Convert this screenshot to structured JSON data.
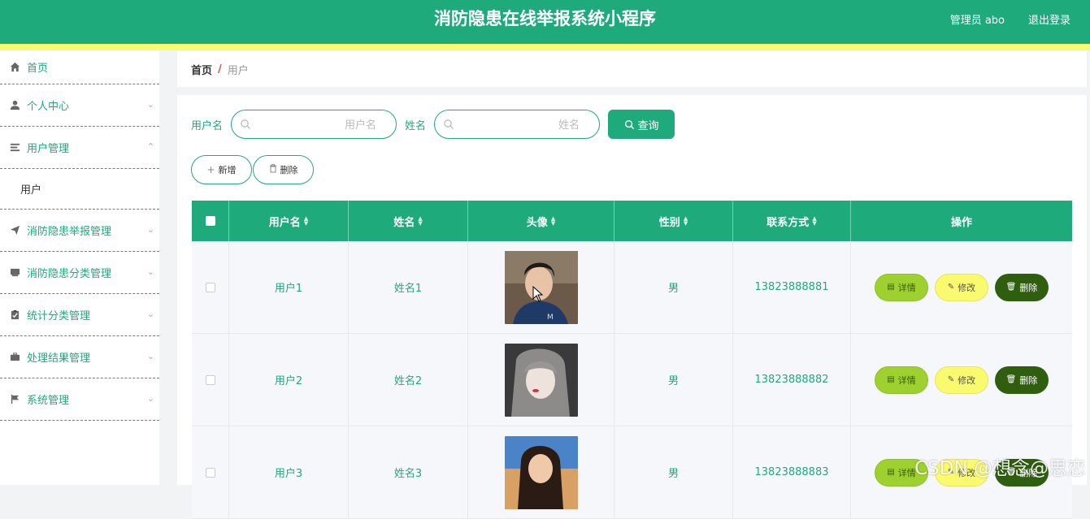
{
  "header": {
    "title": "消防隐患在线举报系统小程序",
    "user": "管理员 abo",
    "logout": "退出登录"
  },
  "sidebar": {
    "items": [
      {
        "label": "首页",
        "icon": "home-icon"
      },
      {
        "label": "个人中心",
        "icon": "person-icon"
      },
      {
        "label": "用户管理",
        "icon": "list-icon",
        "expanded": true
      },
      {
        "label": "消防隐患举报管理",
        "icon": "send-icon"
      },
      {
        "label": "消防隐患分类管理",
        "icon": "tray-icon"
      },
      {
        "label": "统计分类管理",
        "icon": "clipboard-icon"
      },
      {
        "label": "处理结果管理",
        "icon": "briefcase-icon"
      },
      {
        "label": "系统管理",
        "icon": "flag-icon"
      }
    ],
    "sub_item": "用户"
  },
  "breadcrumb": {
    "home": "首页",
    "separator": "/",
    "current": "用户"
  },
  "search": {
    "username_label": "用户名",
    "username_placeholder": "用户名",
    "name_label": "姓名",
    "name_placeholder": "姓名",
    "query_button": "查询"
  },
  "actions": {
    "add": "新增",
    "delete": "删除"
  },
  "table": {
    "columns": [
      "用户名",
      "姓名",
      "头像",
      "性别",
      "联系方式",
      "操作"
    ],
    "rows": [
      {
        "username": "用户1",
        "name": "姓名1",
        "gender": "男",
        "phone": "13823888881"
      },
      {
        "username": "用户2",
        "name": "姓名2",
        "gender": "男",
        "phone": "13823888882"
      },
      {
        "username": "用户3",
        "name": "姓名3",
        "gender": "男",
        "phone": "13823888883"
      }
    ],
    "op_detail": "详情",
    "op_edit": "修改",
    "op_delete": "删除"
  },
  "watermark": "CSDN @想念@思恋",
  "colors": {
    "primary": "#1faa7c",
    "accent_yellow": "#fafa6e",
    "detail_green": "#9ed12f",
    "delete_dark": "#2f5e0e"
  }
}
